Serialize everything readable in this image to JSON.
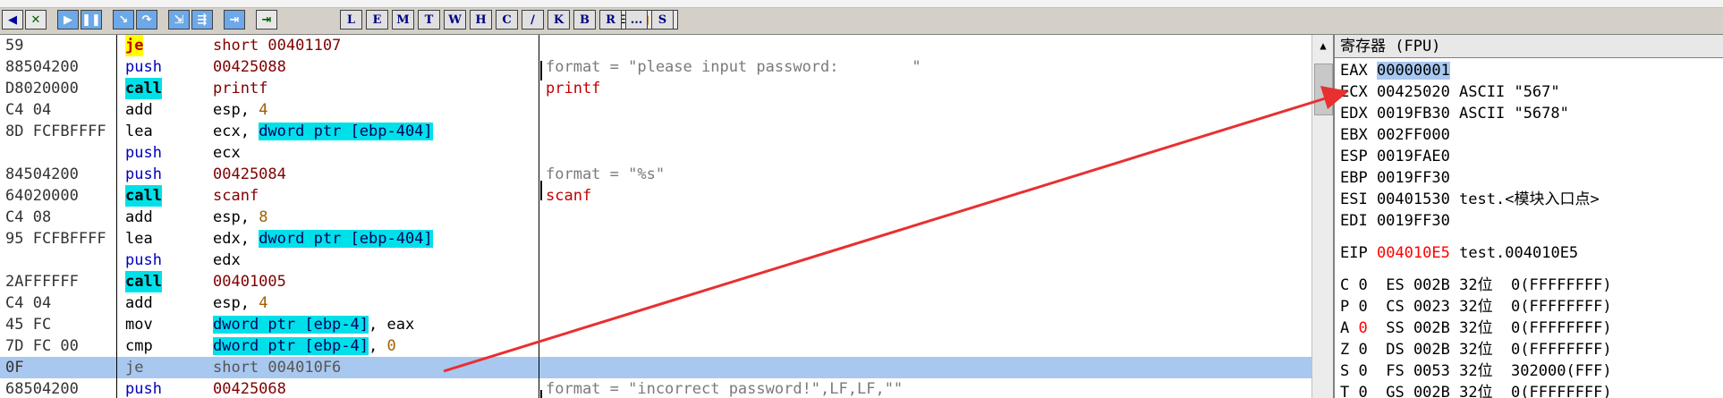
{
  "toolbar": {
    "letters": [
      "L",
      "E",
      "M",
      "T",
      "W",
      "H",
      "C",
      "/",
      "K",
      "B",
      "R",
      "...",
      "S"
    ]
  },
  "disasm": {
    "rows": [
      {
        "addr": "59",
        "mn": "je",
        "mn_style": "jmp",
        "ops": [
          {
            "t": "short 00401107",
            "s": "dark"
          }
        ],
        "cm": ""
      },
      {
        "addr": "88504200",
        "mn": "push",
        "mn_style": "push",
        "ops": [
          {
            "t": "00425088",
            "s": "dark"
          }
        ],
        "cm": "format = \"please input password:        \""
      },
      {
        "addr": "D8020000",
        "mn": "call",
        "mn_style": "call",
        "ops": [
          {
            "t": "printf",
            "s": "dark"
          }
        ],
        "cm": "printf",
        "cm_style": "red"
      },
      {
        "addr": "C4 04",
        "mn": "add",
        "mn_style": "plain",
        "ops": [
          {
            "t": "esp, ",
            "s": "plain"
          },
          {
            "t": "4",
            "s": "num"
          }
        ],
        "cm": ""
      },
      {
        "addr": "8D FCFBFFFF",
        "mn": "lea",
        "mn_style": "plain",
        "ops": [
          {
            "t": "ecx, ",
            "s": "plain"
          },
          {
            "t": "dword ptr [ebp-404]",
            "s": "mem"
          }
        ],
        "cm": ""
      },
      {
        "addr": "",
        "mn": "push",
        "mn_style": "push",
        "ops": [
          {
            "t": "ecx",
            "s": "plain"
          }
        ],
        "cm": ""
      },
      {
        "addr": "84504200",
        "mn": "push",
        "mn_style": "push",
        "ops": [
          {
            "t": "00425084",
            "s": "dark"
          }
        ],
        "cm": "format = \"%s\""
      },
      {
        "addr": "64020000",
        "mn": "call",
        "mn_style": "call",
        "ops": [
          {
            "t": "scanf",
            "s": "dark"
          }
        ],
        "cm": "scanf",
        "cm_style": "red"
      },
      {
        "addr": "C4 08",
        "mn": "add",
        "mn_style": "plain",
        "ops": [
          {
            "t": "esp, ",
            "s": "plain"
          },
          {
            "t": "8",
            "s": "num"
          }
        ],
        "cm": ""
      },
      {
        "addr": "95 FCFBFFFF",
        "mn": "lea",
        "mn_style": "plain",
        "ops": [
          {
            "t": "edx, ",
            "s": "plain"
          },
          {
            "t": "dword ptr [ebp-404]",
            "s": "mem"
          }
        ],
        "cm": ""
      },
      {
        "addr": "",
        "mn": "push",
        "mn_style": "push",
        "ops": [
          {
            "t": "edx",
            "s": "plain"
          }
        ],
        "cm": ""
      },
      {
        "addr": "2AFFFFFF",
        "mn": "call",
        "mn_style": "call",
        "ops": [
          {
            "t": "00401005",
            "s": "dark"
          }
        ],
        "cm": ""
      },
      {
        "addr": "C4 04",
        "mn": "add",
        "mn_style": "plain",
        "ops": [
          {
            "t": "esp, ",
            "s": "plain"
          },
          {
            "t": "4",
            "s": "num"
          }
        ],
        "cm": ""
      },
      {
        "addr": "45 FC",
        "mn": "mov",
        "mn_style": "plain",
        "ops": [
          {
            "t": "dword ptr [ebp-4]",
            "s": "mem"
          },
          {
            "t": ", eax",
            "s": "plain"
          }
        ],
        "cm": ""
      },
      {
        "addr": "7D FC 00",
        "mn": "cmp",
        "mn_style": "plain",
        "ops": [
          {
            "t": "dword ptr [ebp-4]",
            "s": "mem"
          },
          {
            "t": ", ",
            "s": "plain"
          },
          {
            "t": "0",
            "s": "num"
          }
        ],
        "cm": ""
      },
      {
        "addr": "0F",
        "mn": "je",
        "mn_style": "sel",
        "ops": [
          {
            "t": "short 004010F6",
            "s": "sel"
          }
        ],
        "cm": "",
        "selected": true
      },
      {
        "addr": "68504200",
        "mn": "push",
        "mn_style": "push",
        "ops": [
          {
            "t": "00425068",
            "s": "dark"
          }
        ],
        "cm": "format = \"incorrect password!\",LF,LF,\"\""
      }
    ]
  },
  "registers": {
    "header": "寄存器 (FPU)",
    "eax_name": "EAX",
    "eax_value": "00000001",
    "rows": [
      "ECX 00425020 ASCII \"567\"",
      "EDX 0019FB30 ASCII \"5678\"",
      "EBX 002FF000",
      "ESP 0019FAE0",
      "EBP 0019FF30",
      "ESI 00401530 test.<模块入口点>",
      "EDI 0019FF30"
    ],
    "eip_name": "EIP",
    "eip_value": "004010E5",
    "eip_comment": "test.004010E5",
    "flags": [
      {
        "f": "C",
        "v": "0",
        "seg": "ES 002B 32位  0(FFFFFFFF)"
      },
      {
        "f": "P",
        "v": "0",
        "seg": "CS 0023 32位  0(FFFFFFFF)"
      },
      {
        "f": "A",
        "v": "0",
        "seg": "SS 002B 32位  0(FFFFFFFF)",
        "red": true
      },
      {
        "f": "Z",
        "v": "0",
        "seg": "DS 002B 32位  0(FFFFFFFF)"
      },
      {
        "f": "S",
        "v": "0",
        "seg": "FS 0053 32位  302000(FFF)"
      },
      {
        "f": "T",
        "v": "0",
        "seg": "GS 002B 32位  0(FFFFFFFF)"
      }
    ]
  },
  "colors": {
    "annotation_arrow": "#e83030",
    "selection": "#a8c8f0",
    "call_highlight": "#00e0e8",
    "jump_highlight": "#ffff00"
  }
}
